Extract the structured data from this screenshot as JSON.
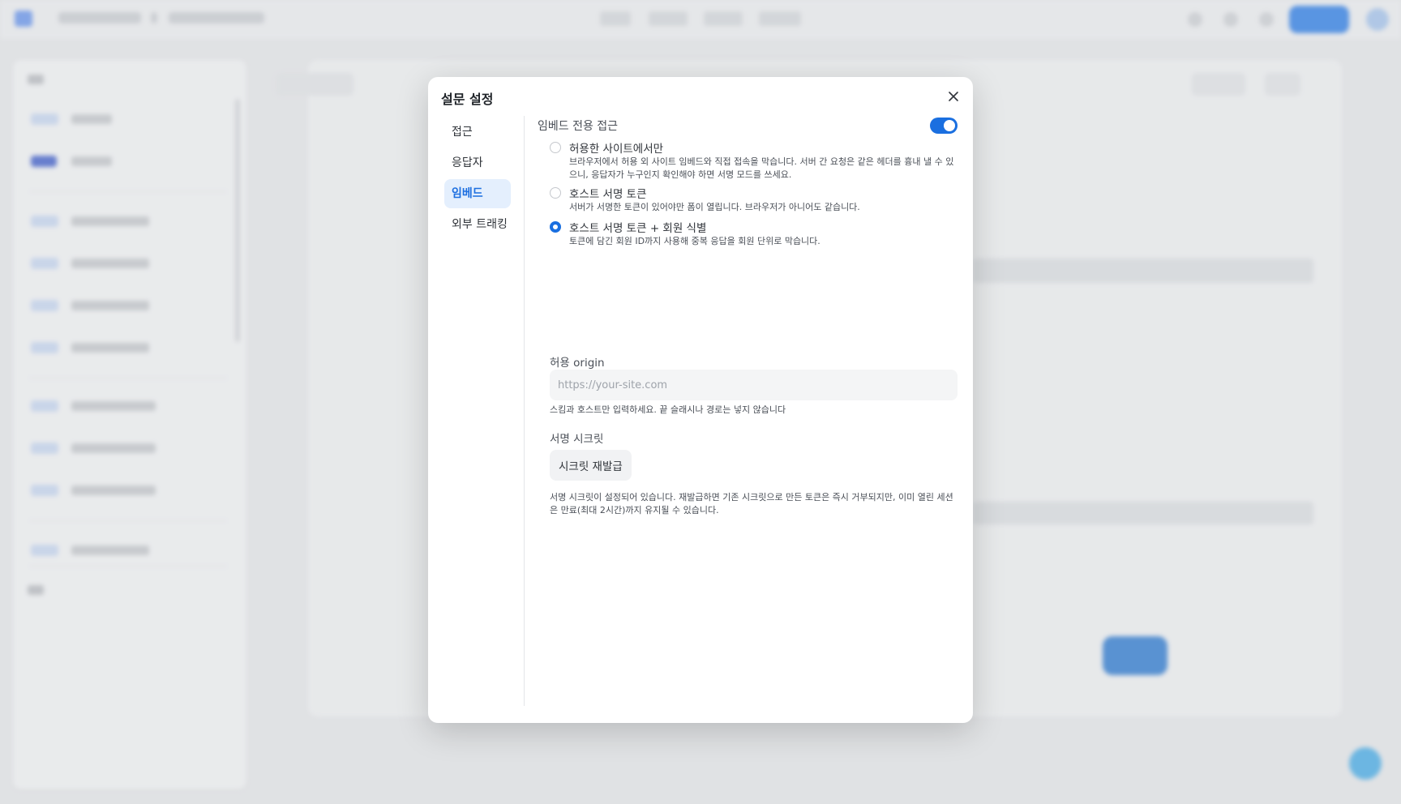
{
  "modal": {
    "title": "설문 설정",
    "tabs": [
      {
        "label": "접근"
      },
      {
        "label": "응답자"
      },
      {
        "label": "임베드"
      },
      {
        "label": "외부 트래킹"
      }
    ],
    "active_tab": "임베드"
  },
  "embed": {
    "section_label": "임베드 전용 접근",
    "toggle_on": true,
    "options": [
      {
        "title": "허용한 사이트에서만",
        "desc": "브라우저에서 허용 외 사이트 임베드와 직접 접속을 막습니다. 서버 간 요청은 같은 헤더를 흉내 낼 수 있으니, 응답자가 누구인지 확인해야 하면 서명 모드를 쓰세요.",
        "selected": false
      },
      {
        "title": "호스트 서명 토큰",
        "desc": "서버가 서명한 토큰이 있어야만 폼이 열립니다. 브라우저가 아니어도 같습니다.",
        "selected": false
      },
      {
        "title": "호스트 서명 토큰 + 회원 식별",
        "desc": "토큰에 담긴 회원 ID까지 사용해 중복 응답을 회원 단위로 막습니다.",
        "selected": true
      }
    ],
    "origin_label": "허용 origin",
    "origin_placeholder": "https://your-site.com",
    "origin_value": "",
    "origin_hint": "스킴과 호스트만 입력하세요. 끝 슬래시나 경로는 넣지 않습니다",
    "secret_label": "서명 시크릿",
    "reissue_button": "시크릿 재발급",
    "secret_hint": "서명 시크릿이 설정되어 있습니다. 재발급하면 기존 시크릿으로 만든 토큰은 즉시 거부되지만, 이미 열린 세션은 만료(최대 2시간)까지 유지될 수 있습니다."
  },
  "colors": {
    "accent": "#1a6fe0",
    "active_tab_bg": "#e4effd"
  }
}
